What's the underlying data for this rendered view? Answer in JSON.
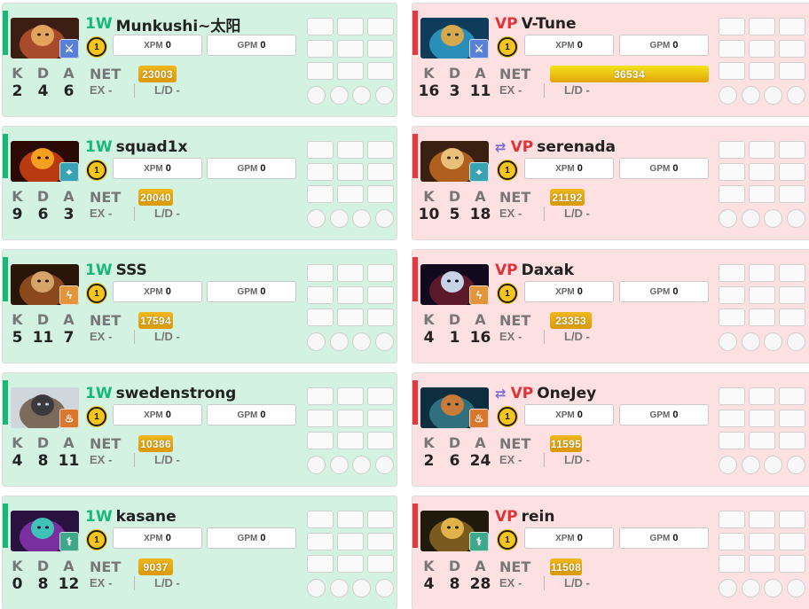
{
  "labels": {
    "xpm": "XPM",
    "gpm": "GPM",
    "k": "K",
    "d": "D",
    "a": "A",
    "net": "NET",
    "ex": "EX -",
    "ld": "L/D -"
  },
  "colors": {
    "radiant_bg": "#d3f2e1",
    "dire_bg": "#fde0e1",
    "radiant_accent": "#17b978",
    "dire_accent": "#e8383d",
    "networth_gold": "#e3a20a"
  },
  "radiant": [
    {
      "team": "1W",
      "name": "Munkushi~太阳",
      "level": "1",
      "xpm": "0",
      "gpm": "0",
      "kills": "2",
      "deaths": "4",
      "assists": "6",
      "net": "23003",
      "net_fraction": 0.24,
      "role_icon": "sword-icon",
      "hero": "red-ogre-hero-portrait"
    },
    {
      "team": "1W",
      "name": "squad1x",
      "level": "1",
      "xpm": "0",
      "gpm": "0",
      "kills": "9",
      "deaths": "6",
      "assists": "3",
      "net": "20040",
      "net_fraction": 0.22,
      "role_icon": "target-icon",
      "hero": "fire-hero-portrait"
    },
    {
      "team": "1W",
      "name": "SSS",
      "level": "1",
      "xpm": "0",
      "gpm": "0",
      "kills": "5",
      "deaths": "11",
      "assists": "7",
      "net": "17594",
      "net_fraction": 0.22,
      "role_icon": "lightning-icon",
      "hero": "bearded-warrior-hero-portrait"
    },
    {
      "team": "1W",
      "name": "swedenstrong",
      "level": "1",
      "xpm": "0",
      "gpm": "0",
      "kills": "4",
      "deaths": "8",
      "assists": "11",
      "net": "10386",
      "net_fraction": 0.22,
      "role_icon": "fire-support-icon",
      "hero": "tusked-hero-portrait"
    },
    {
      "team": "1W",
      "name": "kasane",
      "level": "1",
      "xpm": "0",
      "gpm": "0",
      "kills": "0",
      "deaths": "8",
      "assists": "12",
      "net": "9037",
      "net_fraction": 0.22,
      "role_icon": "hook-support-icon",
      "hero": "purple-mage-hero-portrait"
    }
  ],
  "dire": [
    {
      "team": "VP",
      "name": "V-Tune",
      "swapped": false,
      "level": "1",
      "xpm": "0",
      "gpm": "0",
      "kills": "16",
      "deaths": "3",
      "assists": "11",
      "net": "36534",
      "net_fraction": 1.0,
      "role_icon": "sword-icon",
      "hero": "robot-hero-portrait"
    },
    {
      "team": "VP",
      "name": "serenada",
      "swapped": true,
      "level": "1",
      "xpm": "0",
      "gpm": "0",
      "kills": "10",
      "deaths": "5",
      "assists": "18",
      "net": "21192",
      "net_fraction": 0.22,
      "role_icon": "target-icon",
      "hero": "monkey-king-hero-portrait"
    },
    {
      "team": "VP",
      "name": "Daxak",
      "swapped": false,
      "level": "1",
      "xpm": "0",
      "gpm": "0",
      "kills": "4",
      "deaths": "1",
      "assists": "16",
      "net": "23353",
      "net_fraction": 0.26,
      "role_icon": "lightning-icon",
      "hero": "queen-hero-portrait"
    },
    {
      "team": "VP",
      "name": "OneJey",
      "swapped": true,
      "level": "1",
      "xpm": "0",
      "gpm": "0",
      "kills": "2",
      "deaths": "6",
      "assists": "24",
      "net": "11595",
      "net_fraction": 0.2,
      "role_icon": "fire-support-icon",
      "hero": "rhino-hero-portrait"
    },
    {
      "team": "VP",
      "name": "rein",
      "swapped": false,
      "level": "1",
      "xpm": "0",
      "gpm": "0",
      "kills": "4",
      "deaths": "8",
      "assists": "28",
      "net": "11508",
      "net_fraction": 0.2,
      "role_icon": "hook-support-icon",
      "hero": "armored-hero-portrait"
    }
  ]
}
